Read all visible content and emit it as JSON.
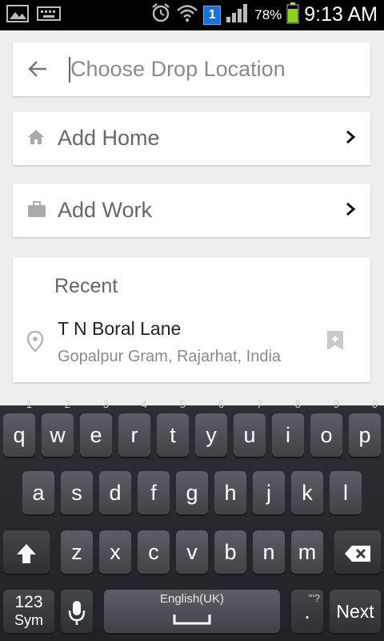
{
  "status_bar": {
    "battery": "78%",
    "time": "9:13 AM",
    "notification_badge": "1"
  },
  "search": {
    "placeholder": "Choose Drop Location"
  },
  "saved_places": [
    {
      "label": "Add Home",
      "icon": "home-icon"
    },
    {
      "label": "Add Work",
      "icon": "briefcase-icon"
    }
  ],
  "recent": {
    "title": "Recent",
    "items": [
      {
        "name": "T N Boral Lane",
        "address": "Gopalpur Gram, Rajarhat, India"
      }
    ]
  },
  "keyboard": {
    "row1": [
      {
        "key": "q",
        "hint": "1"
      },
      {
        "key": "w",
        "hint": "2"
      },
      {
        "key": "e",
        "hint": "3"
      },
      {
        "key": "r",
        "hint": "4"
      },
      {
        "key": "t",
        "hint": "5"
      },
      {
        "key": "y",
        "hint": "6"
      },
      {
        "key": "u",
        "hint": "7"
      },
      {
        "key": "i",
        "hint": "8"
      },
      {
        "key": "o",
        "hint": "9"
      },
      {
        "key": "p",
        "hint": "0"
      }
    ],
    "row2": [
      "a",
      "s",
      "d",
      "f",
      "g",
      "h",
      "j",
      "k",
      "l"
    ],
    "row3": [
      "z",
      "x",
      "c",
      "v",
      "b",
      "n",
      "m"
    ],
    "sym_label_top": "123",
    "sym_label_bottom": "Sym",
    "space_label": "English(UK)",
    "period": ".",
    "period_hint": "'\"?",
    "next_label": "Next"
  }
}
